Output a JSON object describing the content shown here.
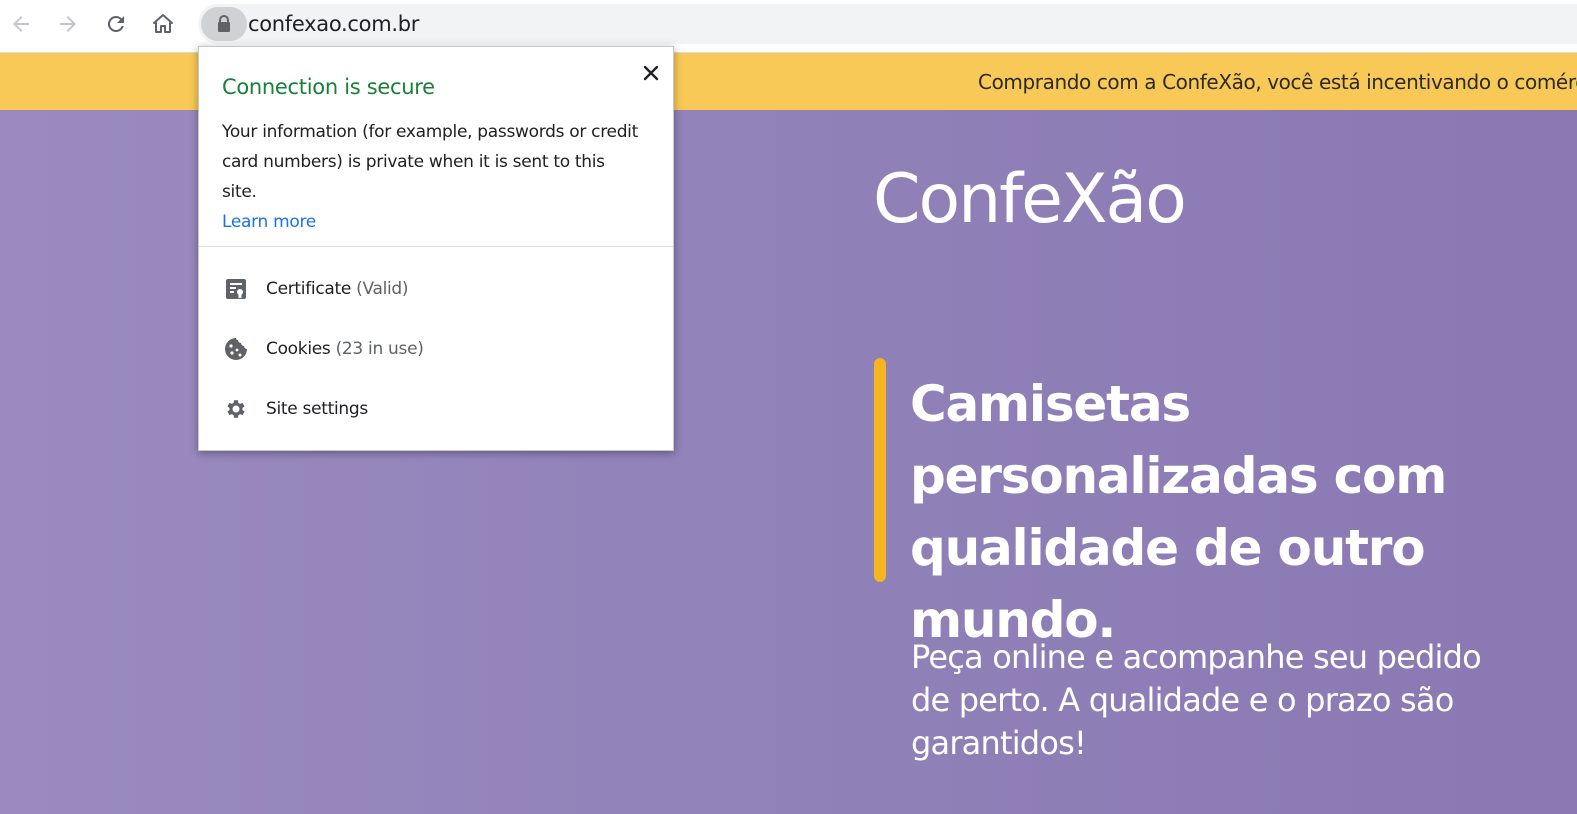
{
  "browser": {
    "url": "confexao.com.br",
    "icons": [
      "back-arrow-icon",
      "forward-arrow-icon",
      "reload-icon",
      "home-icon",
      "lock-icon"
    ]
  },
  "site": {
    "banner_text": "Comprando com a ConfeXão, você está incentivando o comércio l",
    "logo_text": "ConfeXão",
    "headline": "Camisetas personalizadas com qualidade de outro mundo.",
    "subline": "Peça online e acompanhe seu pedido de perto. A qualidade e o prazo são garantidos!",
    "colors": {
      "banner": "#f9c957",
      "hero": "#9283ba",
      "accent": "#f5b522"
    }
  },
  "popup": {
    "title": "Connection is secure",
    "description": "Your information (for example, passwords or credit card numbers) is private when it is sent to this site.",
    "learn_more": "Learn more",
    "items": [
      {
        "label": "Certificate",
        "note": "(Valid)",
        "icon": "certificate-icon"
      },
      {
        "label": "Cookies",
        "note": "(23 in use)",
        "icon": "cookie-icon"
      },
      {
        "label": "Site settings",
        "note": "",
        "icon": "gear-icon"
      }
    ],
    "colors": {
      "title": "#188038",
      "link": "#1a73e8"
    }
  }
}
